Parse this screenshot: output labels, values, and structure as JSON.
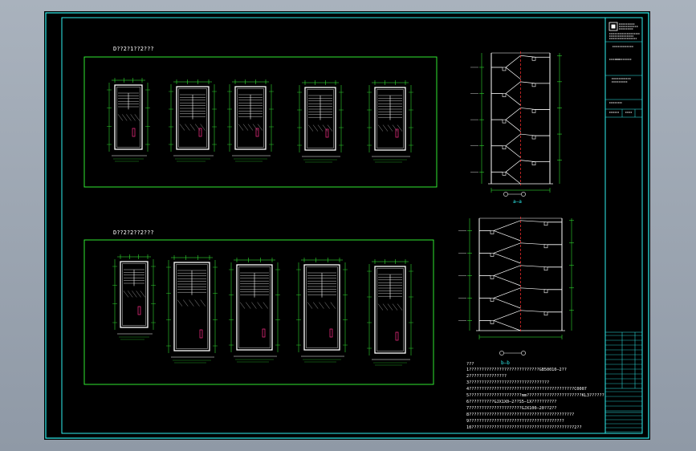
{
  "drawing": {
    "section1_title": "D??2?1??2???",
    "section2_title": "D??2?2??2???",
    "section_a_label": "a—a",
    "section_b_label": "b—b",
    "notes_heading": "???",
    "notes": [
      "1????????????????????????????GB50010—2??",
      "2???????????????",
      "3????????????????????????????????",
      "4??????????????????????????????????????????C0007",
      "5?????????????????????mm??????????????????????KL3??????",
      "6??????????GJX1X0—2??S5—1X??????????",
      "7?????????????????????GJX100—20??2??",
      "8??????????????????????????????????????????",
      "9??????????????????????????????????????",
      "10?????????????????????????????????????????2??"
    ]
  },
  "colors": {
    "paper": "#000000",
    "frame": "#2ff0f0",
    "panel": "#37ff37",
    "dim": "#37ff37",
    "wall": "#ffffff",
    "stair": "#ffffff",
    "accent": "#ff2f8a",
    "cut_line": "#ff3030"
  }
}
